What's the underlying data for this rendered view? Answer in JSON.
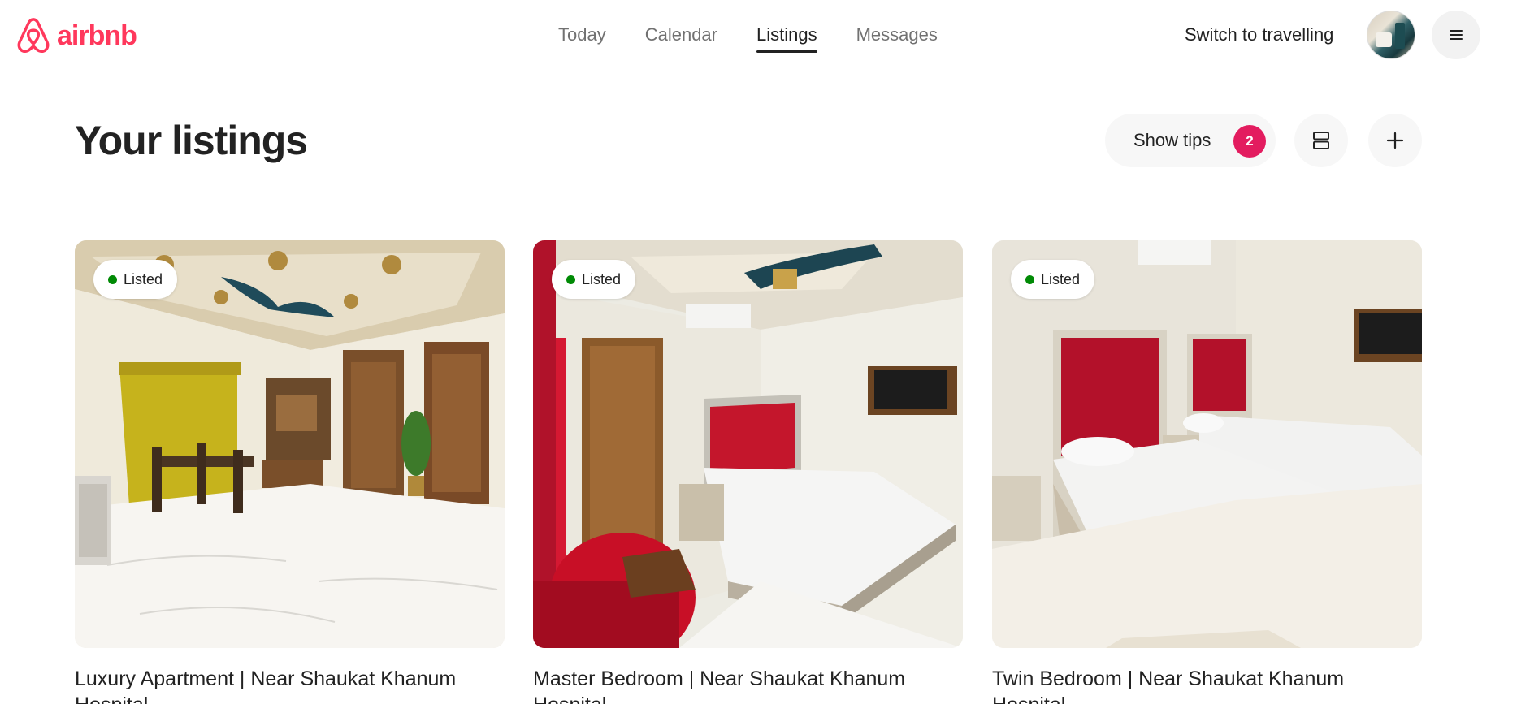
{
  "brand": {
    "name": "airbnb",
    "color": "#ff385c",
    "logo_icon": "airbnb-logo-icon"
  },
  "nav": {
    "items": [
      {
        "label": "Today",
        "active": false
      },
      {
        "label": "Calendar",
        "active": false
      },
      {
        "label": "Listings",
        "active": true
      },
      {
        "label": "Messages",
        "active": false
      }
    ]
  },
  "header": {
    "switch_label": "Switch to travelling",
    "avatar_icon": "user-avatar",
    "menu_icon": "hamburger-menu-icon"
  },
  "page": {
    "title": "Your listings",
    "tips_label": "Show tips",
    "tips_count": "2",
    "tips_badge_color": "#e31c5f",
    "layout_icon": "view-layout-icon",
    "add_icon": "plus-icon"
  },
  "listings": [
    {
      "status": "Listed",
      "title": "Luxury Apartment | Near Shaukat Khanum Hospital"
    },
    {
      "status": "Listed",
      "title": "Master Bedroom | Near Shaukat Khanum Hospital"
    },
    {
      "status": "Listed",
      "title": "Twin Bedroom | Near Shaukat Khanum Hospital"
    }
  ],
  "colors": {
    "listed_dot": "#008a05",
    "text": "#222222",
    "muted": "#717171"
  }
}
